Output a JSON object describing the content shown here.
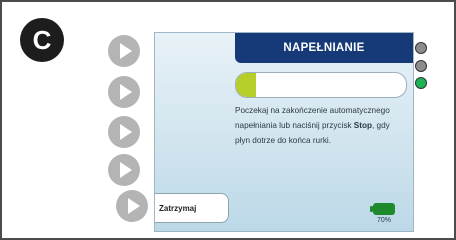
{
  "step_badge": "C",
  "screen": {
    "title": "NAPEŁNIANIE",
    "progress_fraction": 0.12,
    "progress_color": "#b6cd2a",
    "message": {
      "before_bold": "Poczekaj na zakończenie automatycznego napełniania lub naciśnij przycisk ",
      "bold": "Stop",
      "after_bold": ", gdy płyn dotrze do końca rurki."
    },
    "stop_button_label": "Zatrzymaj",
    "battery_level": "70%",
    "battery_color": "#1f8a2b"
  },
  "side_buttons": [
    {
      "icon": "play-icon"
    },
    {
      "icon": "play-icon"
    },
    {
      "icon": "play-icon"
    },
    {
      "icon": "play-icon"
    },
    {
      "icon": "play-icon"
    }
  ],
  "status_lights": [
    {
      "state": "off",
      "color": "#8c8c8c"
    },
    {
      "state": "off",
      "color": "#8c8c8c"
    },
    {
      "state": "on",
      "color": "#1db354"
    }
  ]
}
